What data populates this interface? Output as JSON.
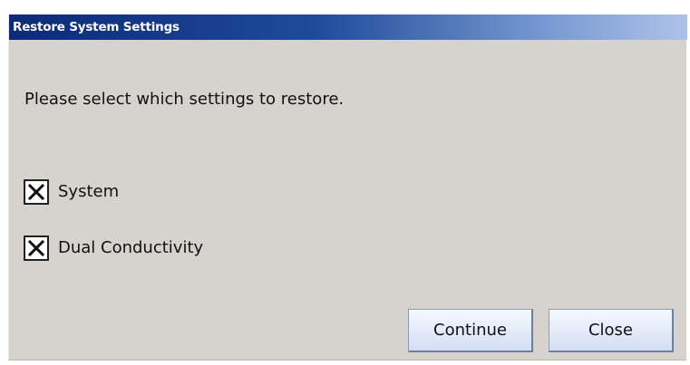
{
  "dialog": {
    "title": "Restore System Settings",
    "prompt": "Please select which settings to restore."
  },
  "options": [
    {
      "label": "System",
      "checked": true
    },
    {
      "label": "Dual Conductivity",
      "checked": true
    }
  ],
  "buttons": {
    "continue_label": "Continue",
    "close_label": "Close"
  },
  "colors": {
    "titlebar_start": "#0c2a78",
    "titlebar_end": "#aec2e8",
    "dialog_background": "#d6d3ce",
    "button_face": "#e4ecfa"
  },
  "icons": {
    "checkbox_mark": "x-mark-icon"
  }
}
